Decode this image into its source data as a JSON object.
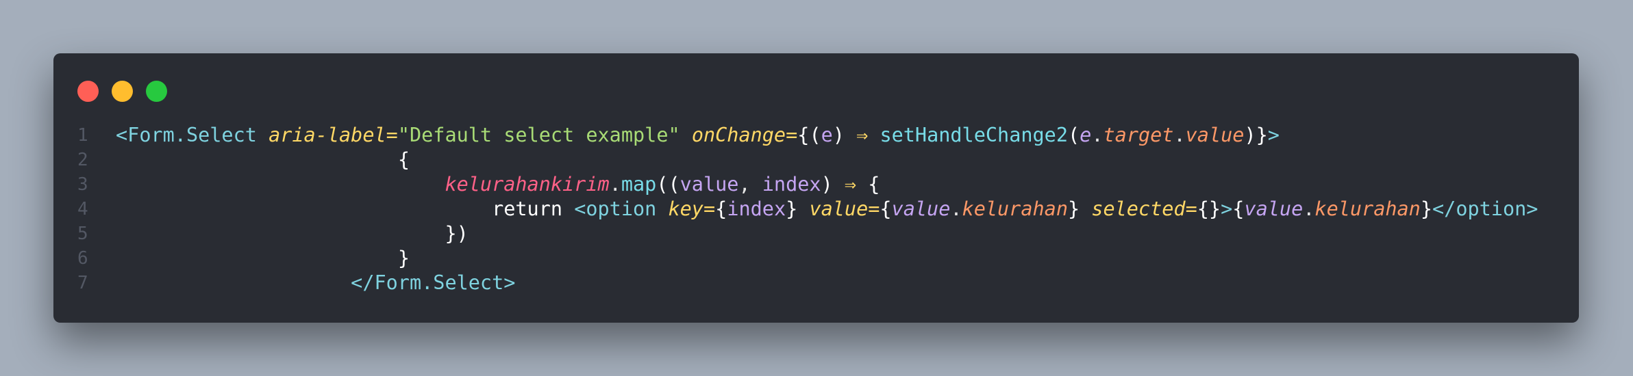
{
  "window": {
    "controls": [
      "close-button",
      "minimize-button",
      "maximize-button"
    ]
  },
  "colors": {
    "background": "#a4aebb",
    "window": "#292c33",
    "close": "#ff5f56",
    "minimize": "#ffbd2e",
    "maximize": "#27c93f",
    "tag": "#7fd3e0",
    "attribute": "#ffd866",
    "string": "#a9dc76",
    "variable": "#ff6188",
    "parameter": "#c5a5f2",
    "property": "#fc9867"
  },
  "code": {
    "lines": [
      {
        "number": "1",
        "tokens": [
          {
            "text": "<Form.Select ",
            "type": "tag"
          },
          {
            "text": "aria-label",
            "type": "attr"
          },
          {
            "text": "=",
            "type": "op"
          },
          {
            "text": "\"Default select example\"",
            "type": "string"
          },
          {
            "text": " ",
            "type": "default"
          },
          {
            "text": "onChange",
            "type": "attr"
          },
          {
            "text": "=",
            "type": "op"
          },
          {
            "text": "{",
            "type": "brace"
          },
          {
            "text": "(",
            "type": "paren"
          },
          {
            "text": "e",
            "type": "param"
          },
          {
            "text": ") ",
            "type": "paren"
          },
          {
            "text": "⇒",
            "type": "arrow"
          },
          {
            "text": " ",
            "type": "default"
          },
          {
            "text": "setHandleChange2",
            "type": "func"
          },
          {
            "text": "(",
            "type": "paren"
          },
          {
            "text": "e",
            "type": "obj"
          },
          {
            "text": ".",
            "type": "punct"
          },
          {
            "text": "target",
            "type": "prop"
          },
          {
            "text": ".",
            "type": "punct"
          },
          {
            "text": "value",
            "type": "prop"
          },
          {
            "text": ")",
            "type": "paren"
          },
          {
            "text": "}",
            "type": "brace"
          },
          {
            "text": ">",
            "type": "tag"
          }
        ]
      },
      {
        "number": "2",
        "tokens": [
          {
            "text": "                        ",
            "type": "default"
          },
          {
            "text": "{",
            "type": "brace"
          }
        ]
      },
      {
        "number": "3",
        "tokens": [
          {
            "text": "                            ",
            "type": "default"
          },
          {
            "text": "kelurahankirim",
            "type": "var"
          },
          {
            "text": ".",
            "type": "punct"
          },
          {
            "text": "map",
            "type": "func"
          },
          {
            "text": "((",
            "type": "paren"
          },
          {
            "text": "value",
            "type": "param"
          },
          {
            "text": ", ",
            "type": "punct"
          },
          {
            "text": "index",
            "type": "param"
          },
          {
            "text": ") ",
            "type": "paren"
          },
          {
            "text": "⇒",
            "type": "arrow"
          },
          {
            "text": " {",
            "type": "brace"
          }
        ]
      },
      {
        "number": "4",
        "tokens": [
          {
            "text": "                                ",
            "type": "default"
          },
          {
            "text": "return",
            "type": "keyword"
          },
          {
            "text": " ",
            "type": "default"
          },
          {
            "text": "<option ",
            "type": "tag"
          },
          {
            "text": "key",
            "type": "attr"
          },
          {
            "text": "=",
            "type": "op"
          },
          {
            "text": "{",
            "type": "brace"
          },
          {
            "text": "index",
            "type": "param"
          },
          {
            "text": "} ",
            "type": "brace"
          },
          {
            "text": "value",
            "type": "attr"
          },
          {
            "text": "=",
            "type": "op"
          },
          {
            "text": "{",
            "type": "brace"
          },
          {
            "text": "value",
            "type": "obj"
          },
          {
            "text": ".",
            "type": "punct"
          },
          {
            "text": "kelurahan",
            "type": "prop"
          },
          {
            "text": "} ",
            "type": "brace"
          },
          {
            "text": "selected",
            "type": "attr"
          },
          {
            "text": "=",
            "type": "op"
          },
          {
            "text": "{}",
            "type": "brace"
          },
          {
            "text": ">",
            "type": "tag"
          },
          {
            "text": "{",
            "type": "brace"
          },
          {
            "text": "value",
            "type": "obj"
          },
          {
            "text": ".",
            "type": "punct"
          },
          {
            "text": "kelurahan",
            "type": "prop"
          },
          {
            "text": "}",
            "type": "brace"
          },
          {
            "text": "</option>",
            "type": "tag"
          }
        ]
      },
      {
        "number": "5",
        "tokens": [
          {
            "text": "                            ",
            "type": "default"
          },
          {
            "text": "})",
            "type": "brace"
          }
        ]
      },
      {
        "number": "6",
        "tokens": [
          {
            "text": "                        ",
            "type": "default"
          },
          {
            "text": "}",
            "type": "brace"
          }
        ]
      },
      {
        "number": "7",
        "tokens": [
          {
            "text": "                    ",
            "type": "default"
          },
          {
            "text": "</Form.Select>",
            "type": "tag"
          }
        ]
      }
    ]
  }
}
